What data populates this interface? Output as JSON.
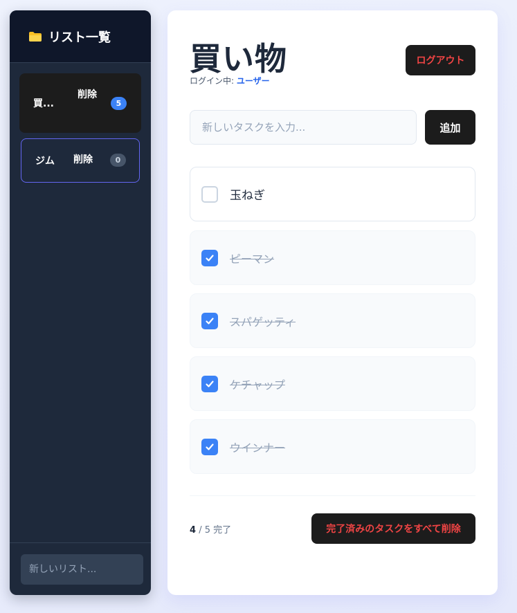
{
  "sidebar": {
    "title": "リスト一覧",
    "lists": [
      {
        "name": "買...",
        "delete_label": "削除",
        "count": "5"
      },
      {
        "name": "ジム",
        "delete_label": "削除",
        "count": "0"
      }
    ],
    "new_list_placeholder": "新しいリスト..."
  },
  "main": {
    "title": "買い物",
    "login_prefix": "ログイン中:",
    "login_user": "ユーザー",
    "logout_label": "ログアウト",
    "task_placeholder": "新しいタスクを入力...",
    "add_label": "追加",
    "tasks": [
      {
        "text": "玉ねぎ",
        "done": false
      },
      {
        "text": "ピーマン",
        "done": true
      },
      {
        "text": "スパゲッティ",
        "done": true
      },
      {
        "text": "ケチャップ",
        "done": true
      },
      {
        "text": "ウインナー",
        "done": true
      }
    ],
    "progress_done": "4",
    "progress_rest": "/ 5 完了",
    "clear_label": "完了済みのタスクをすべて削除"
  },
  "colors": {
    "accent": "#3b82f6",
    "danger": "#ef4444",
    "sidebar_bg": "#1e293b"
  }
}
